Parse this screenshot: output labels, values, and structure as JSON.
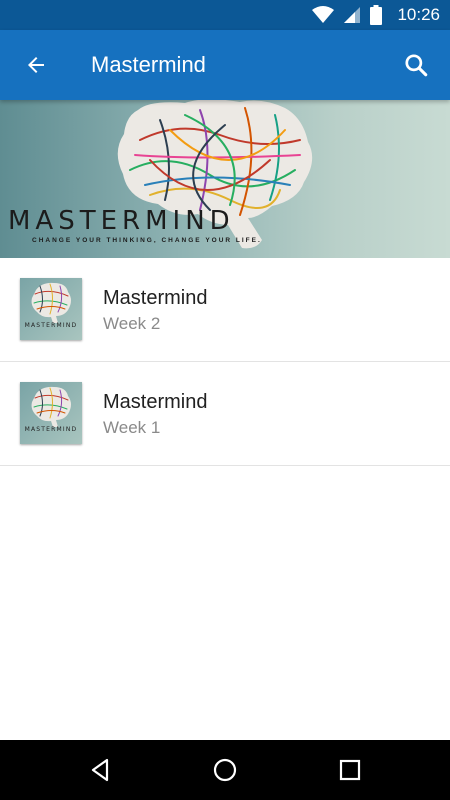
{
  "status_bar": {
    "time": "10:26",
    "icons": [
      "wifi-icon",
      "signal-icon",
      "battery-icon"
    ]
  },
  "app_bar": {
    "title": "Mastermind",
    "back_icon": "arrow-left-icon",
    "search_icon": "search-icon",
    "color": "#1671bf"
  },
  "banner": {
    "title": "MASTERMIND",
    "subtitle": "CHANGE YOUR THINKING, CHANGE YOUR LIFE."
  },
  "list": {
    "items": [
      {
        "title": "Mastermind",
        "subtitle": "Week 2",
        "thumb_text": "MASTERMIND"
      },
      {
        "title": "Mastermind",
        "subtitle": "Week 1",
        "thumb_text": "MASTERMIND"
      }
    ]
  },
  "nav_bar": {
    "icons": [
      "back-triangle-icon",
      "home-circle-icon",
      "recents-square-icon"
    ]
  }
}
